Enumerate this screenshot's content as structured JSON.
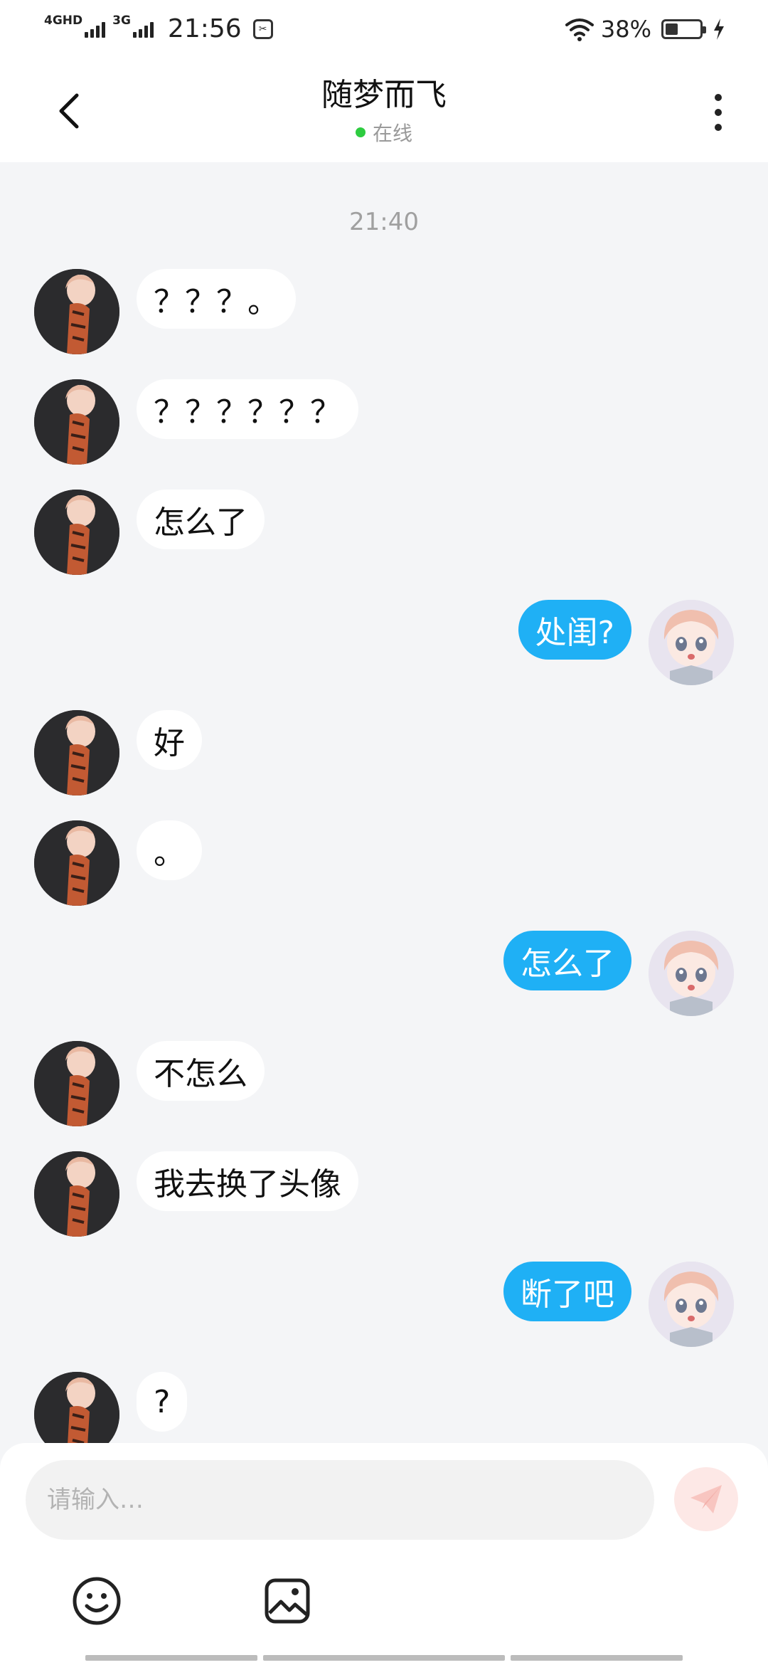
{
  "status_bar": {
    "network_1": "4GHD",
    "network_2": "3G",
    "time": "21:56",
    "battery_percent": "38%",
    "battery_level": 0.38
  },
  "header": {
    "contact_name": "随梦而飞",
    "status_text": "在线"
  },
  "chat": {
    "timestamp": "21:40",
    "messages": [
      {
        "side": "other",
        "text": "？？？。"
      },
      {
        "side": "other",
        "text": "？？？？？？"
      },
      {
        "side": "other",
        "text": "怎么了"
      },
      {
        "side": "me",
        "text": "处闺?"
      },
      {
        "side": "other",
        "text": "好"
      },
      {
        "side": "other",
        "text": "。"
      },
      {
        "side": "me",
        "text": "怎么了"
      },
      {
        "side": "other",
        "text": "不怎么"
      },
      {
        "side": "other",
        "text": "我去换了头像"
      },
      {
        "side": "me",
        "text": "断了吧"
      },
      {
        "side": "other",
        "text": "?"
      }
    ]
  },
  "input": {
    "placeholder": "请输入…"
  },
  "colors": {
    "my_bubble": "#1fb0f5",
    "other_bubble": "#ffffff",
    "online_dot": "#2ecc40",
    "chat_background": "#f4f5f7"
  },
  "icons": {
    "back": "chevron-left-icon",
    "more": "more-vertical-icon",
    "send": "paper-plane-icon",
    "emoji": "smiley-icon",
    "image": "image-icon"
  }
}
